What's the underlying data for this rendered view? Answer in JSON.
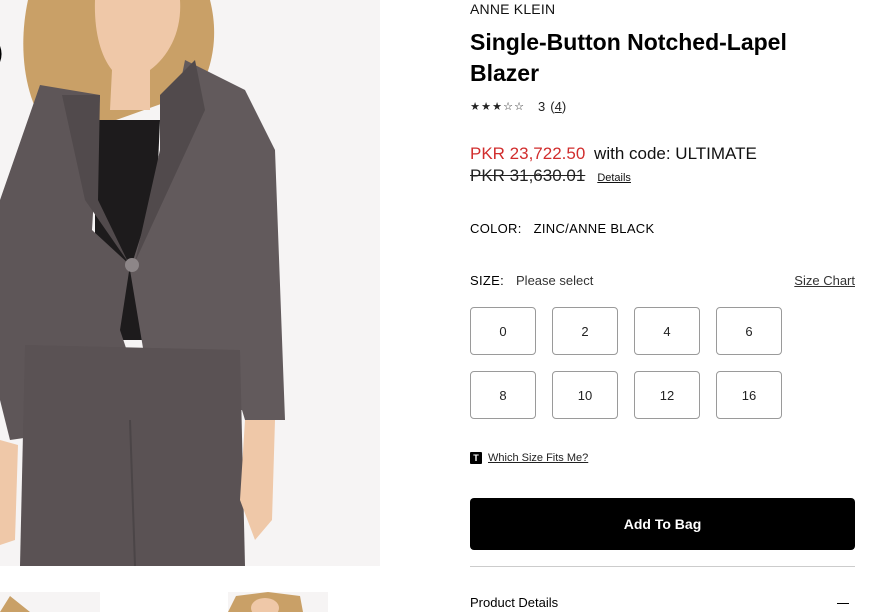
{
  "product": {
    "brand": "ANNE KLEIN",
    "title": "Single-Button Notched-Lapel Blazer",
    "rating": {
      "stars": [
        "★",
        "★",
        "★",
        "☆",
        "☆"
      ],
      "value": "3",
      "count_open": "(",
      "count": "4",
      "count_close": ")"
    },
    "price": {
      "sale": "PKR 23,722.50",
      "promo": "with code: ULTIMATE",
      "original": "PKR 31,630.01",
      "details_link": "Details"
    },
    "color": {
      "label": "COLOR:",
      "value": "ZINC/ANNE BLACK"
    },
    "size": {
      "label": "SIZE:",
      "hint": "Please select",
      "chart_link": "Size Chart",
      "options": [
        "0",
        "2",
        "4",
        "6",
        "8",
        "10",
        "12",
        "16"
      ]
    },
    "fit": {
      "icon_letter": "T",
      "link": "Which Size Fits Me?"
    },
    "add_to_bag": "Add To Bag",
    "product_details": "Product Details"
  },
  "colors": {
    "sale_price": "#d12d2d",
    "button_bg": "#000000",
    "image_bg": "#f6f4f4",
    "blazer": "#5e5658"
  }
}
